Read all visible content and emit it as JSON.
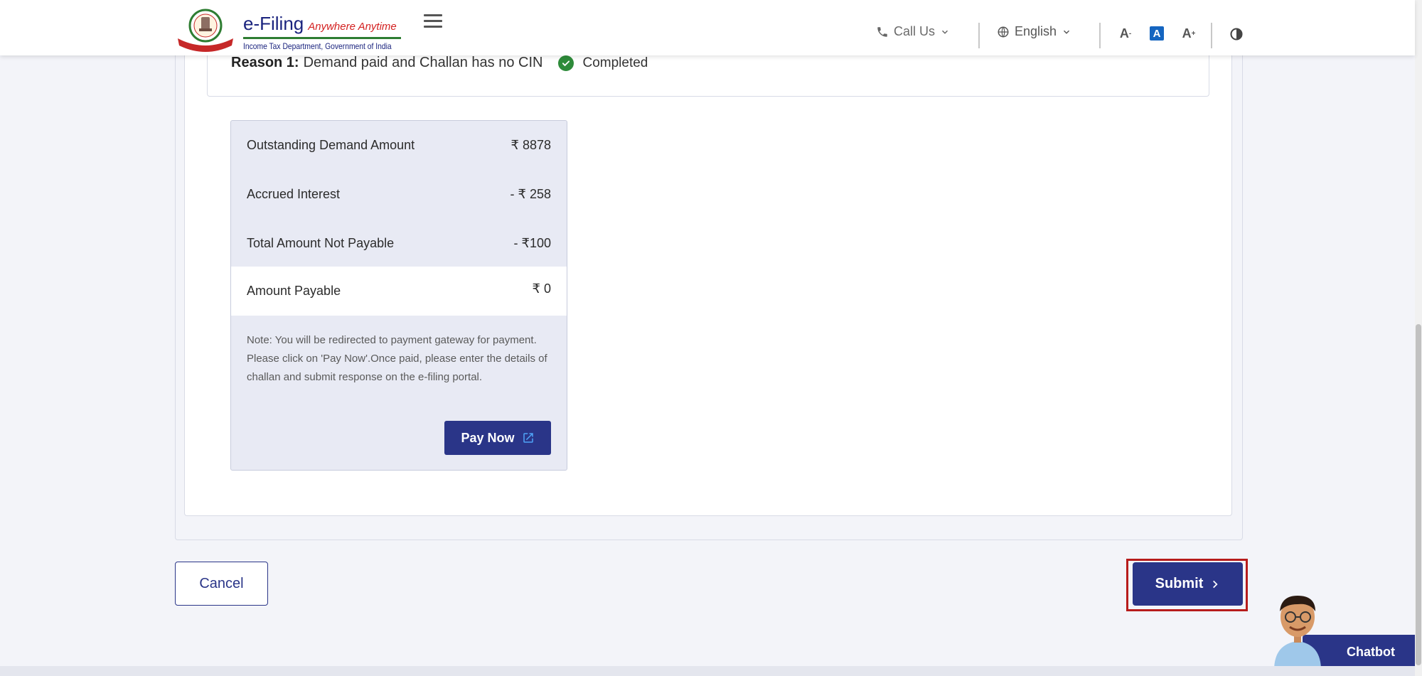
{
  "header": {
    "brand_main": "e-Filing",
    "brand_tagline": "Anywhere Anytime",
    "brand_sub": "Income Tax Department, Government of India",
    "call_us": "Call Us",
    "language": "English",
    "font_decrease": "A",
    "font_default": "A",
    "font_increase": "A"
  },
  "reason": {
    "label": "Reason 1:",
    "text": "Demand paid and Challan has no CIN",
    "status": "Completed"
  },
  "summary": {
    "rows": [
      {
        "label": "Outstanding Demand Amount",
        "value": "₹ 8878"
      },
      {
        "label": "Accrued Interest",
        "value": "-  ₹ 258"
      },
      {
        "label": "Total Amount Not Payable",
        "value": "-  ₹100"
      },
      {
        "label": "Amount Payable",
        "value": "₹ 0"
      }
    ],
    "note": "Note: You will be redirected to payment gateway for payment. Please click on 'Pay Now'.Once paid, please enter the details of challan and submit response on the e-filing portal.",
    "pay_now": "Pay Now"
  },
  "actions": {
    "cancel": "Cancel",
    "submit": "Submit"
  },
  "chatbot": {
    "label": "Chatbot"
  },
  "colors": {
    "primary": "#2a3588",
    "success": "#2e8b3a",
    "highlight": "#b71c1c"
  }
}
